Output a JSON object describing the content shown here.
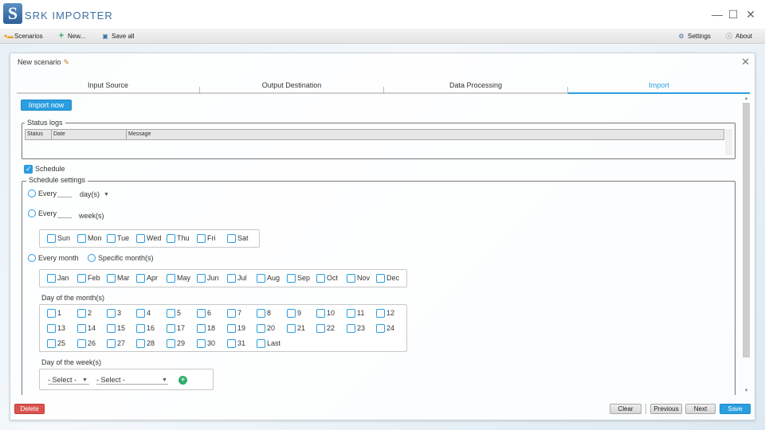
{
  "app": {
    "logo_letter": "S",
    "title": "SRK IMPORTER"
  },
  "window_controls": {
    "minimize": "—",
    "maximize": "☐",
    "close": "✕"
  },
  "toolbar": {
    "scenarios": "Scenarios",
    "new": "New...",
    "save_all": "Save all",
    "settings": "Settings",
    "about": "About"
  },
  "dialog": {
    "title": "New scenario",
    "tabs": [
      "Input Source",
      "Output Destination",
      "Data Processing",
      "Import"
    ],
    "active_tab": "Import"
  },
  "import_now": "Import now",
  "status_logs": {
    "legend": "Status logs",
    "columns": [
      "Status",
      "Date",
      "Message"
    ]
  },
  "schedule": {
    "label": "Schedule",
    "checked": true,
    "settings_legend": "Schedule settings",
    "every_label": "Every",
    "day_unit": "day(s)",
    "week_unit": "week(s)",
    "weekdays": [
      "Sun",
      "Mon",
      "Tue",
      "Wed",
      "Thu",
      "Fri",
      "Sat"
    ],
    "every_month": "Every month",
    "specific_months": "Specific month(s)",
    "months": [
      "Jan",
      "Feb",
      "Mar",
      "Apr",
      "May",
      "Jun",
      "Jul",
      "Aug",
      "Sep",
      "Oct",
      "Nov",
      "Dec"
    ],
    "day_of_month_label": "Day of the month(s)",
    "days": [
      "1",
      "2",
      "3",
      "4",
      "5",
      "6",
      "7",
      "8",
      "9",
      "10",
      "11",
      "12",
      "13",
      "14",
      "15",
      "16",
      "17",
      "18",
      "19",
      "20",
      "21",
      "22",
      "23",
      "24",
      "25",
      "26",
      "27",
      "28",
      "29",
      "30",
      "31",
      "Last"
    ],
    "day_of_week_label": "Day of the week(s)",
    "select_placeholder": "- Select -"
  },
  "footer": {
    "delete": "Delete",
    "clear": "Clear",
    "previous": "Previous",
    "next": "Next",
    "save": "Save"
  },
  "colors": {
    "accent": "#2a9ee0",
    "danger": "#d9534f",
    "add": "#2eae6a",
    "brand": "#3e6fa3"
  }
}
